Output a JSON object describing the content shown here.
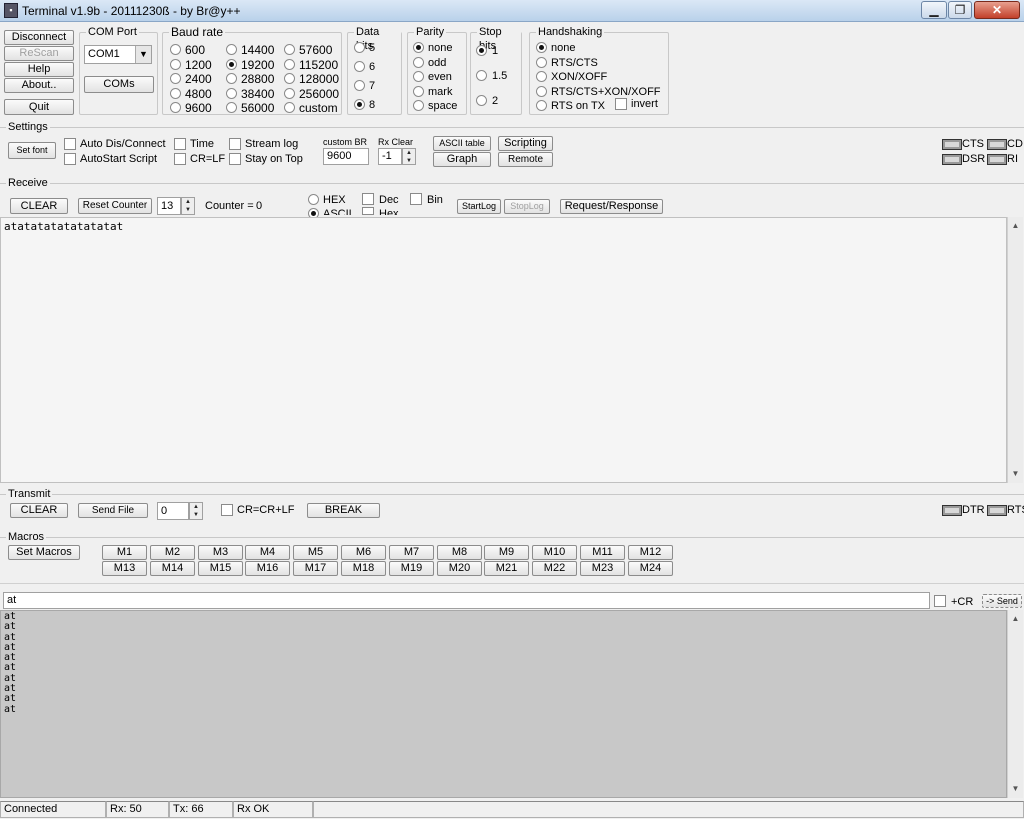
{
  "window": {
    "title": "Terminal v1.9b - 20111230ß - by Br@y++"
  },
  "left_buttons": {
    "disconnect": "Disconnect",
    "rescan": "ReScan",
    "help": "Help",
    "about": "About..",
    "quit": "Quit"
  },
  "com_port": {
    "caption": "COM Port",
    "value": "COM1",
    "coms_button": "COMs"
  },
  "baud": {
    "caption": "Baud rate",
    "col1": [
      "600",
      "1200",
      "2400",
      "4800",
      "9600"
    ],
    "col2": [
      "14400",
      "19200",
      "28800",
      "38400",
      "56000"
    ],
    "col3": [
      "57600",
      "115200",
      "128000",
      "256000",
      "custom"
    ],
    "selected": "19200"
  },
  "data_bits": {
    "caption": "Data bits",
    "options": [
      "5",
      "6",
      "7",
      "8"
    ],
    "selected": "8"
  },
  "parity": {
    "caption": "Parity",
    "options": [
      "none",
      "odd",
      "even",
      "mark",
      "space"
    ],
    "selected": "none"
  },
  "stop_bits": {
    "caption": "Stop bits",
    "options": [
      "1",
      "1.5",
      "2"
    ],
    "selected": "1"
  },
  "handshaking": {
    "caption": "Handshaking",
    "options": [
      "none",
      "RTS/CTS",
      "XON/XOFF",
      "RTS/CTS+XON/XOFF",
      "RTS on TX"
    ],
    "invert": "invert",
    "selected": "none"
  },
  "settings": {
    "caption": "Settings",
    "set_font": "Set font",
    "auto_dis_connect": "Auto Dis/Connect",
    "autostart_script": "AutoStart Script",
    "time": "Time",
    "cr_lf": "CR=LF",
    "stream_log": "Stream log",
    "stay_on_top": "Stay on Top",
    "custom_br_label": "custom BR",
    "custom_br_value": "9600",
    "rx_clear_label": "Rx Clear",
    "rx_clear_value": "-1",
    "ascii_table": "ASCII table",
    "scripting": "Scripting",
    "graph": "Graph",
    "remote": "Remote",
    "leds": {
      "cts": "CTS",
      "cd": "CD",
      "dsr": "DSR",
      "ri": "RI"
    }
  },
  "receive": {
    "caption": "Receive",
    "clear": "CLEAR",
    "reset_counter": "Reset Counter",
    "counter_spin": "13",
    "counter_label": "Counter =",
    "counter_value": "0",
    "hex": "HEX",
    "ascii": "ASCII",
    "dec": "Dec",
    "hex2": "Hex",
    "bin": "Bin",
    "start_log": "StartLog",
    "stop_log": "StopLog",
    "request_response": "Request/Response",
    "content": "atatatatatatatatat"
  },
  "transmit": {
    "caption": "Transmit",
    "clear": "CLEAR",
    "send_file": "Send File",
    "spin_value": "0",
    "cr_crlf": "CR=CR+LF",
    "break": "BREAK",
    "leds": {
      "dtr": "DTR",
      "rts": "RTS"
    }
  },
  "macros": {
    "caption": "Macros",
    "set_macros": "Set Macros",
    "row1": [
      "M1",
      "M2",
      "M3",
      "M4",
      "M5",
      "M6",
      "M7",
      "M8",
      "M9",
      "M10",
      "M11",
      "M12"
    ],
    "row2": [
      "M13",
      "M14",
      "M15",
      "M16",
      "M17",
      "M18",
      "M19",
      "M20",
      "M21",
      "M22",
      "M23",
      "M24"
    ]
  },
  "send": {
    "input_value": "at",
    "plus_cr": "+CR",
    "send_button": "-> Send"
  },
  "transmit_log": [
    "at",
    "at",
    "at",
    "at",
    "at",
    "at",
    "at",
    "at",
    "at",
    "at"
  ],
  "status": {
    "state": "Connected",
    "rx": "Rx: 50",
    "tx": "Tx: 66",
    "rx_ok": "Rx OK"
  }
}
